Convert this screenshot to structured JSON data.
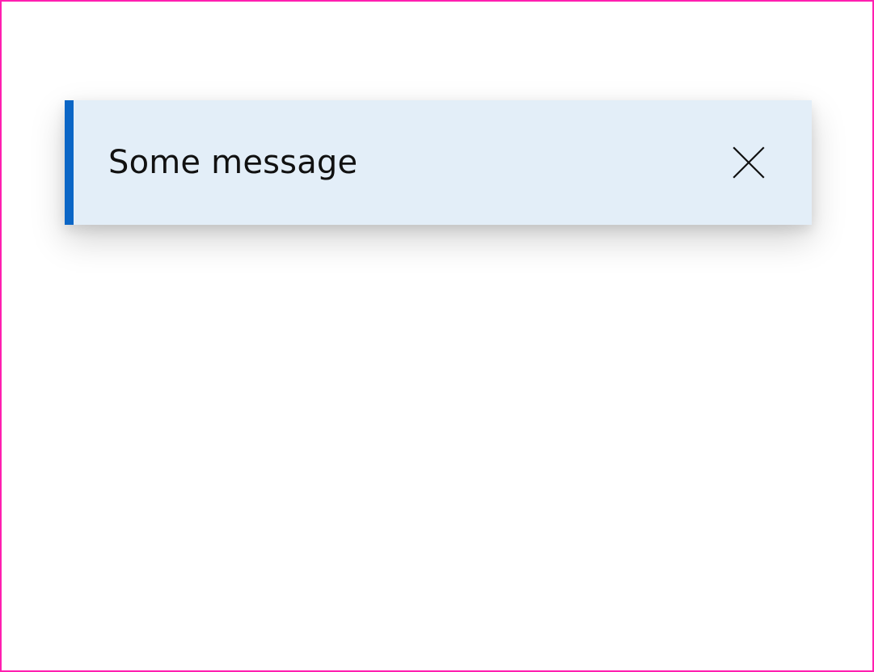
{
  "colors": {
    "frame_border": "#ff1fb0",
    "toast_background": "#e3eef8",
    "toast_accent": "#0b66c6",
    "text": "#111111",
    "icon": "#111111"
  },
  "toast": {
    "message": "Some message",
    "close_icon": "close-icon"
  }
}
